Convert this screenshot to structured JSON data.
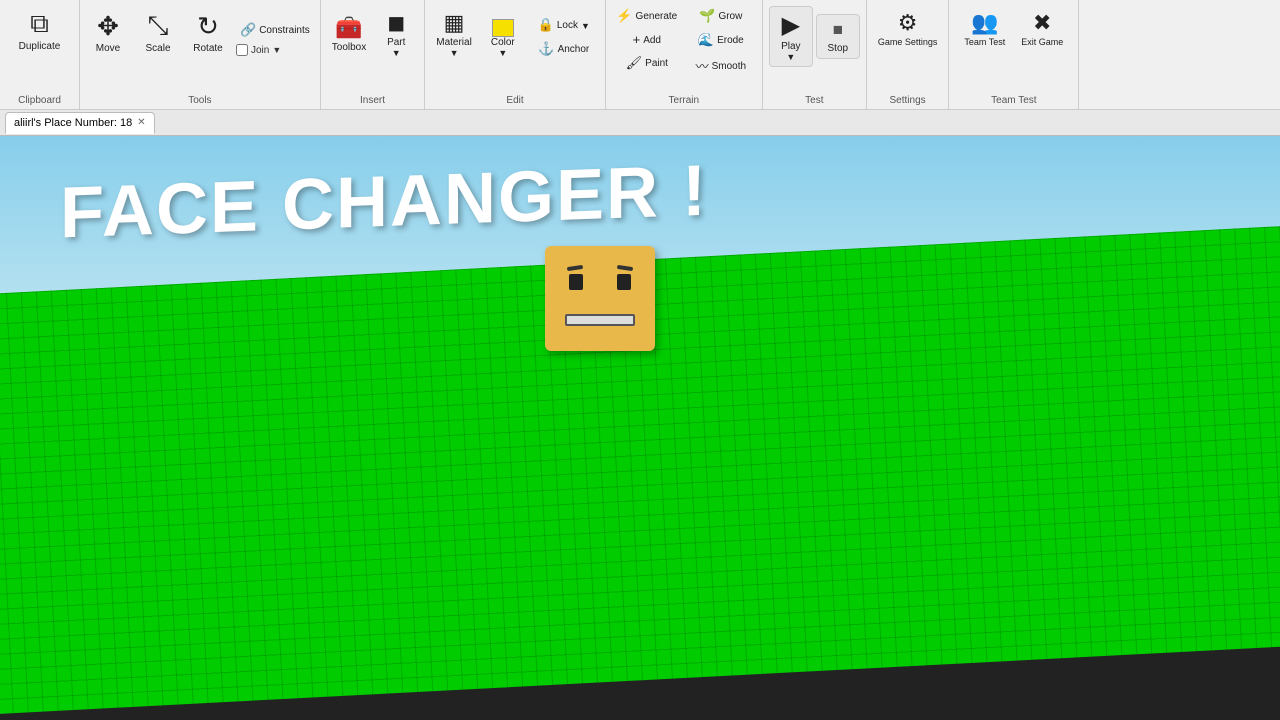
{
  "toolbar": {
    "sections": [
      {
        "id": "clipboard",
        "label": "Clipboard",
        "buttons": [
          {
            "id": "duplicate",
            "icon": "⧉",
            "label": "Duplicate"
          }
        ]
      },
      {
        "id": "tools",
        "label": "Tools",
        "buttons": [
          {
            "id": "move",
            "icon": "✥",
            "label": "Move"
          },
          {
            "id": "scale",
            "icon": "⤡",
            "label": "Scale"
          },
          {
            "id": "rotate",
            "icon": "↻",
            "label": "Rotate"
          },
          {
            "id": "constraints",
            "icon": "🔗",
            "label": "Constraints"
          },
          {
            "id": "join",
            "icon": "☐",
            "label": "Join"
          }
        ]
      },
      {
        "id": "insert",
        "label": "Insert",
        "buttons": [
          {
            "id": "toolbox",
            "icon": "🧰",
            "label": "Toolbox"
          },
          {
            "id": "part",
            "icon": "◼",
            "label": "Part"
          }
        ]
      },
      {
        "id": "edit",
        "label": "Edit",
        "buttons": [
          {
            "id": "material",
            "icon": "▦",
            "label": "Material"
          },
          {
            "id": "color",
            "icon": "■",
            "label": "Color"
          },
          {
            "id": "lock",
            "icon": "🔒",
            "label": "Lock"
          },
          {
            "id": "anchor",
            "icon": "⚓",
            "label": "Anchor"
          }
        ]
      },
      {
        "id": "terrain",
        "label": "Terrain",
        "buttons": [
          {
            "id": "generate",
            "icon": "⚡",
            "label": "Generate"
          },
          {
            "id": "add",
            "icon": "+",
            "label": "Add"
          },
          {
            "id": "paint",
            "icon": "🖌",
            "label": "Paint"
          },
          {
            "id": "grow",
            "icon": "▲",
            "label": "Grow"
          },
          {
            "id": "erode",
            "icon": "▼",
            "label": "Erode"
          },
          {
            "id": "smooth",
            "icon": "~",
            "label": "Smooth"
          }
        ]
      },
      {
        "id": "test",
        "label": "Test",
        "buttons": [
          {
            "id": "play",
            "icon": "▶",
            "label": "Play"
          },
          {
            "id": "stop",
            "icon": "■",
            "label": "Stop"
          }
        ]
      },
      {
        "id": "settings",
        "label": "Settings",
        "buttons": [
          {
            "id": "gamesettings",
            "icon": "⚙",
            "label": "Game\nSettings"
          }
        ]
      },
      {
        "id": "teamtest",
        "label": "Team Test",
        "buttons": [
          {
            "id": "teamtest-btn",
            "icon": "👥",
            "label": "Team\nTest"
          },
          {
            "id": "exitgame",
            "icon": "✖",
            "label": "Exit\nGame"
          }
        ]
      }
    ]
  },
  "tabs": [
    {
      "id": "tab1",
      "label": "aliirl's Place Number: 18",
      "active": true
    }
  ],
  "viewport": {
    "title": "FACE CHANGER !",
    "character": {
      "expression": "smirk"
    }
  },
  "toolbar_labels": {
    "clipboard": "Clipboard",
    "tools": "Tools",
    "insert": "Insert",
    "edit": "Edit",
    "terrain": "Terrain",
    "test": "Test",
    "settings": "Settings",
    "teamtest": "Team Test",
    "duplicate": "Duplicate",
    "move": "Move",
    "scale": "Scale",
    "rotate": "Rotate",
    "constraints": "Constraints",
    "join": "Join",
    "toolbox": "Toolbox",
    "part": "Part",
    "material": "Material",
    "color": "Color",
    "lock": "Lock",
    "anchor": "Anchor",
    "generate": "Generate",
    "add": "Add",
    "paint": "Paint",
    "grow": "Grow",
    "erode": "Erode",
    "smooth": "Smooth",
    "play": "Play",
    "stop": "Stop",
    "game_settings": "Game Settings",
    "team_test": "Team Test",
    "exit_game": "Exit Game",
    "tab_label": "aliirl's Place Number: 18",
    "face_changer": "FACE CHANGER !"
  }
}
